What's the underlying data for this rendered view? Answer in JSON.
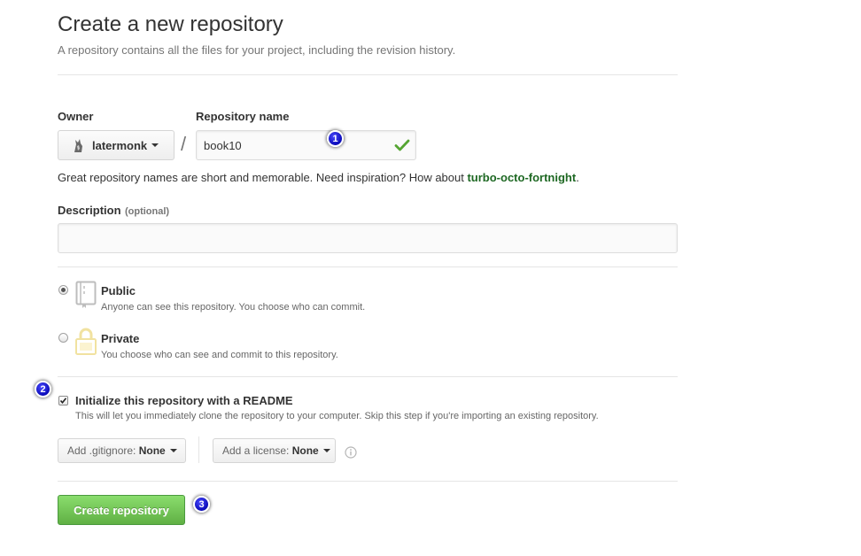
{
  "header": {
    "title": "Create a new repository",
    "subtitle": "A repository contains all the files for your project, including the revision history."
  },
  "owner": {
    "label": "Owner",
    "value": "latermonk"
  },
  "separator": "/",
  "repo_name": {
    "label": "Repository name",
    "value": "book10"
  },
  "hint": {
    "prefix": "Great repository names are short and memorable. Need inspiration? How about ",
    "suggestion": "turbo-octo-fortnight",
    "suffix": "."
  },
  "description": {
    "label": "Description",
    "optional": "(optional)",
    "value": "",
    "placeholder": ""
  },
  "visibility": {
    "public": {
      "title": "Public",
      "desc": "Anyone can see this repository. You choose who can commit.",
      "selected": true
    },
    "private": {
      "title": "Private",
      "desc": "You choose who can see and commit to this repository.",
      "selected": false
    }
  },
  "readme": {
    "title": "Initialize this repository with a README",
    "desc": "This will let you immediately clone the repository to your computer. Skip this step if you're importing an existing repository.",
    "checked": true
  },
  "gitignore": {
    "prefix": "Add .gitignore:",
    "value": "None"
  },
  "license": {
    "prefix": "Add a license:",
    "value": "None"
  },
  "create_button": "Create repository",
  "badges": [
    "1",
    "2",
    "3"
  ],
  "colors": {
    "accent_green": "#60b044",
    "suggestion_green": "#1e6823",
    "badge_blue": "#0a0ab8"
  }
}
